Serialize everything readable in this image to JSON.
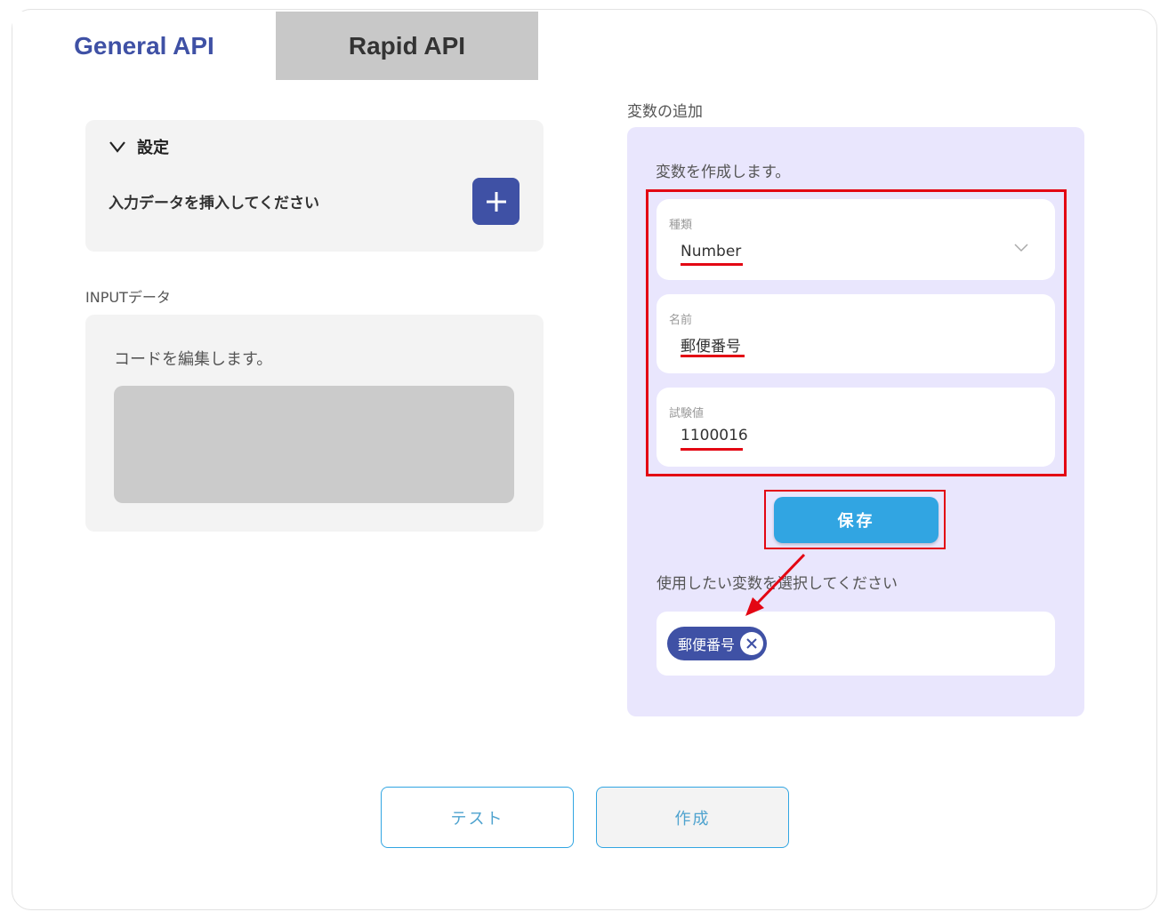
{
  "tabs": [
    {
      "label": "General API",
      "active": true
    },
    {
      "label": "Rapid API",
      "active": false
    }
  ],
  "settings": {
    "title": "設定",
    "prompt": "入力データを挿入してください",
    "toggle_icon": "chevron-down-icon",
    "add_icon": "plus-icon"
  },
  "input_data": {
    "label": "INPUTデータ",
    "description": "コードを編集します。"
  },
  "variable": {
    "heading": "変数の追加",
    "description": "変数を作成します。",
    "fields": {
      "type": {
        "label": "種類",
        "value": "Number"
      },
      "name": {
        "label": "名前",
        "value": "郵便番号"
      },
      "test_value": {
        "label": "試験値",
        "value": "1100016"
      }
    },
    "save_label": "保存",
    "select_prompt": "使用したい変数を選択してください",
    "selected_chips": [
      "郵便番号"
    ]
  },
  "actions": {
    "test_label": "テスト",
    "create_label": "作成"
  },
  "colors": {
    "accent": "#3f51a5",
    "save_button": "#31a5e2",
    "annotation_red": "#e30613",
    "variable_panel": "#e9e6fd"
  }
}
